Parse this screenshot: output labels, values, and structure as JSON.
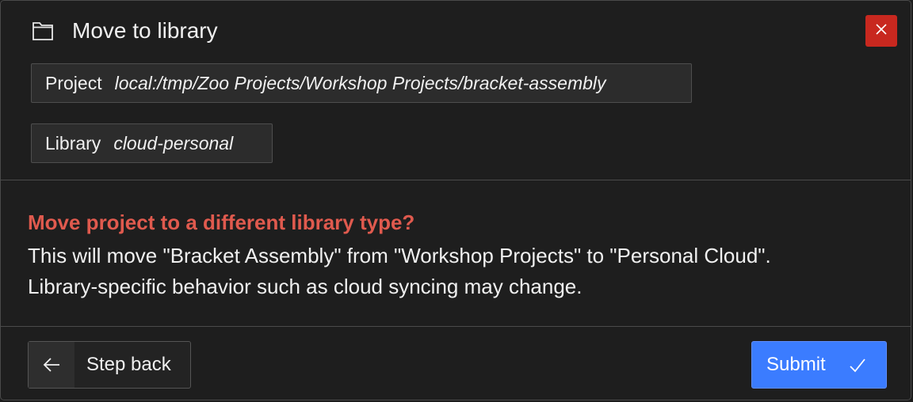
{
  "dialog": {
    "title": "Move to library",
    "icons": {
      "title": "folder-icon",
      "close": "close-icon",
      "back": "arrow-left-icon",
      "submit": "checkmark-icon"
    },
    "close_color": "#c8281f"
  },
  "fields": [
    {
      "key": "Project",
      "value": "local:/tmp/Zoo Projects/Workshop Projects/bracket-assembly"
    },
    {
      "key": "Library",
      "value": "cloud-personal"
    }
  ],
  "warning": {
    "title": "Move project to a different library type?",
    "body": "This will move \"Bracket Assembly\" from \"Workshop Projects\" to \"Personal Cloud\". Library-specific behavior such as cloud syncing may change.",
    "title_color": "#e05a4e"
  },
  "footer": {
    "back_label": "Step back",
    "submit_label": "Submit",
    "submit_color": "#3b7cff"
  }
}
